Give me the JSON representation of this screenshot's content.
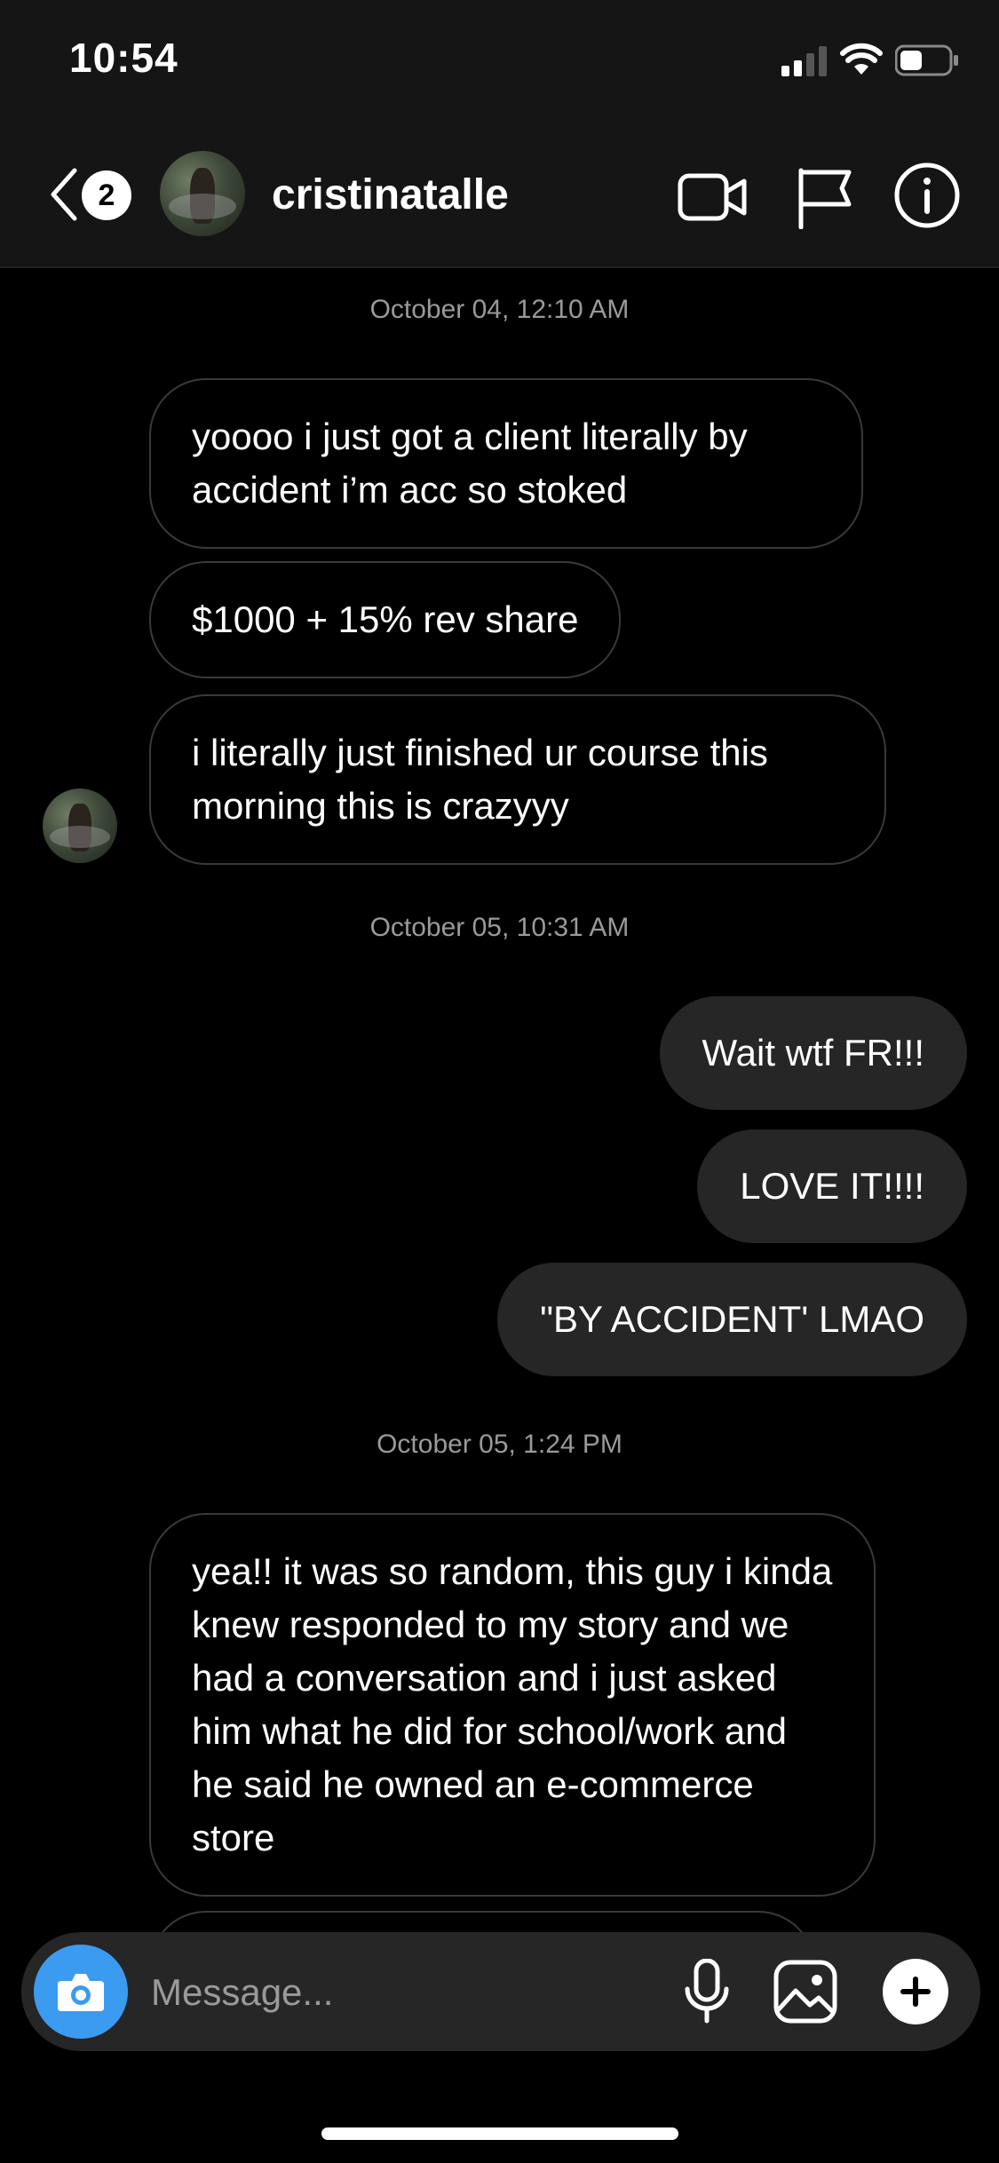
{
  "status_bar": {
    "time": "10:54"
  },
  "header": {
    "unread_count": "2",
    "username": "cristinatalle"
  },
  "conversation": {
    "timestamps": [
      "October 04, 12:10 AM",
      "October 05, 10:31 AM",
      "October 05, 1:24 PM"
    ],
    "messages": [
      {
        "sender": "them",
        "text": "yoooo i just got a client literally by accident i’m acc so stoked"
      },
      {
        "sender": "them",
        "text": "$1000 + 15% rev share"
      },
      {
        "sender": "them",
        "text": "i literally just finished ur course this morning this is crazyyy"
      },
      {
        "sender": "me",
        "text": "Wait wtf FR!!!"
      },
      {
        "sender": "me",
        "text": "LOVE IT!!!!"
      },
      {
        "sender": "me",
        "text": "\"BY ACCIDENT' LMAO"
      },
      {
        "sender": "them",
        "text": "yea!! it was so random, this guy i kinda knew responded to my story and we had a conversation and i just asked him what he did for school/work and he said he owned an e-commerce store"
      }
    ]
  },
  "composer": {
    "placeholder": "Message..."
  },
  "icons": {
    "back": "chevron-left-icon",
    "video": "video-camera-icon",
    "flag": "flag-icon",
    "info": "info-icon",
    "camera": "camera-icon",
    "mic": "microphone-icon",
    "gallery": "image-icon",
    "plus": "plus-icon"
  },
  "colors": {
    "background": "#000000",
    "header_background": "#151515",
    "outgoing_bubble": "#262626",
    "incoming_border": "#3a3a3a",
    "camera_button": "#3b9bf0",
    "timestamp_text": "#9a9a9a"
  }
}
